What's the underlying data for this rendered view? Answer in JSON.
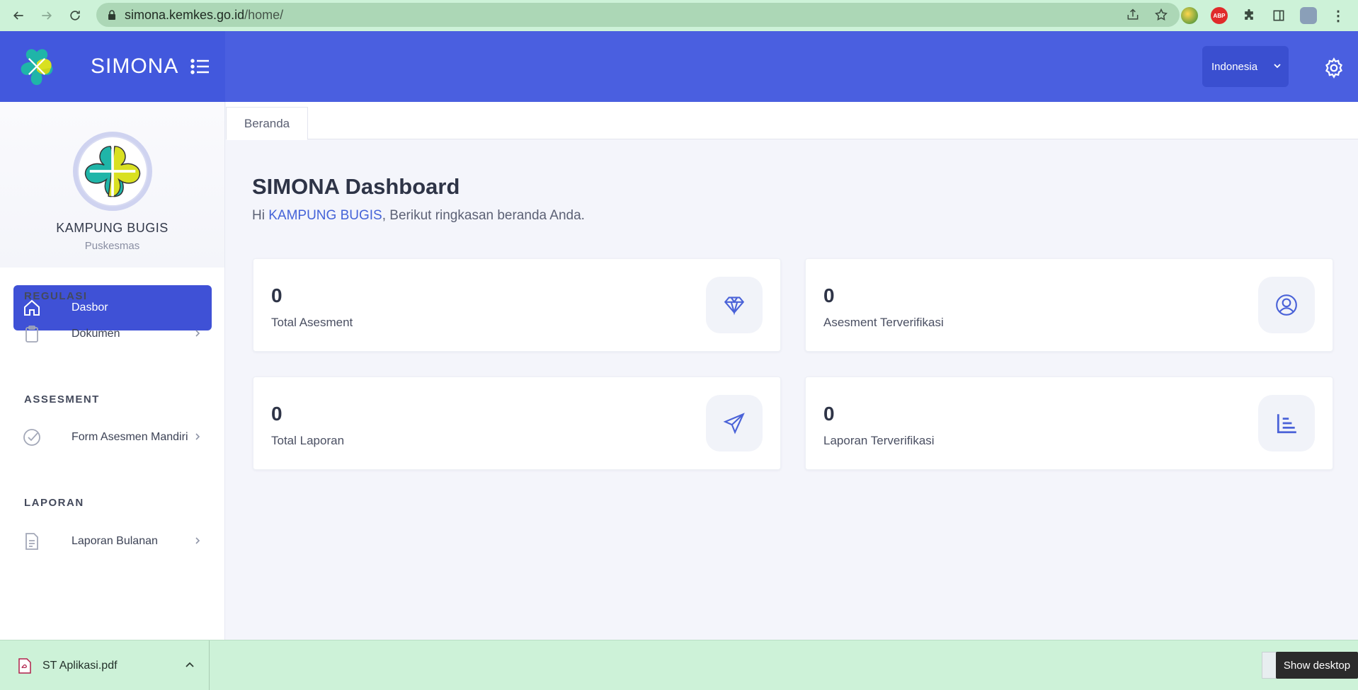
{
  "browser": {
    "url_host": "simona.kemkes.go.id",
    "url_path": "/home/",
    "extensions": [
      "globe-icon",
      "abp-icon",
      "puzzle-icon",
      "side-panel-icon",
      "profile-avatar",
      "kebab-menu-icon"
    ],
    "abp_label": "ABP"
  },
  "header": {
    "brand": "SIMONA",
    "language": "Indonesia",
    "accent": "#4a5fe0"
  },
  "sidebar": {
    "profile_name": "KAMPUNG BUGIS",
    "profile_role": "Puskesmas",
    "active_item": "Dasbor",
    "sections": [
      {
        "title": "REGULASI",
        "item": "Dokumen"
      },
      {
        "title": "ASSESMENT",
        "item": "Form Asesmen Mandiri"
      },
      {
        "title": "LAPORAN",
        "item": "Laporan Bulanan"
      }
    ]
  },
  "main": {
    "tab": "Beranda",
    "title": "SIMONA Dashboard",
    "greeting_prefix": "Hi ",
    "greeting_name": "KAMPUNG BUGIS",
    "greeting_suffix": ", Berikut ringkasan beranda Anda.",
    "cards": [
      {
        "value": "0",
        "label": "Total Asesment",
        "icon": "diamond-icon"
      },
      {
        "value": "0",
        "label": "Asesment Terverifikasi",
        "icon": "user-circle-icon"
      },
      {
        "value": "0",
        "label": "Total Laporan",
        "icon": "send-icon"
      },
      {
        "value": "0",
        "label": "Laporan Terverifikasi",
        "icon": "bar-chart-icon"
      }
    ]
  },
  "downloads": {
    "file": "ST Aplikasi.pdf",
    "tooltip": "Show desktop"
  }
}
